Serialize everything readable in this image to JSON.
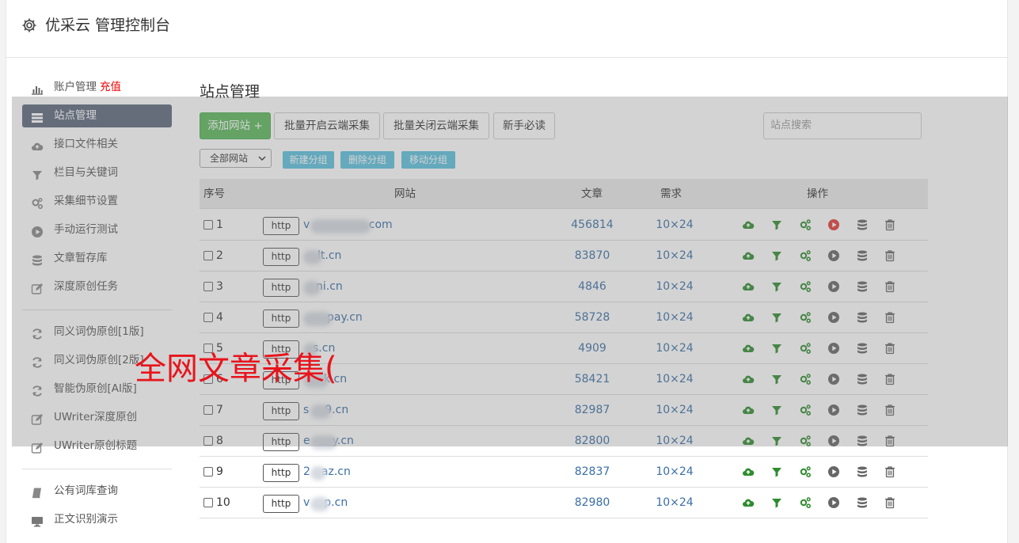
{
  "header": {
    "title": "优采云 管理控制台"
  },
  "sidebar": {
    "items": [
      {
        "label": "账户管理",
        "badge": "充值",
        "icon": "bar-chart-icon"
      },
      {
        "label": "站点管理",
        "icon": "list-icon",
        "active": true
      },
      {
        "label": "接口文件相关",
        "icon": "cloud-upload-icon"
      },
      {
        "label": "栏目与关键词",
        "icon": "filter-icon"
      },
      {
        "label": "采集细节设置",
        "icon": "gears-icon"
      },
      {
        "label": "手动运行测试",
        "icon": "play-icon"
      },
      {
        "label": "文章暂存库",
        "icon": "database-icon"
      },
      {
        "label": "深度原创任务",
        "icon": "edit-icon"
      },
      {
        "label": "同义词伪原创[1版]",
        "icon": "refresh-icon"
      },
      {
        "label": "同义词伪原创[2版]",
        "icon": "refresh-icon"
      },
      {
        "label": "智能伪原创[AI版]",
        "icon": "refresh-icon"
      },
      {
        "label": "UWriter深度原创",
        "icon": "edit-icon"
      },
      {
        "label": "UWriter原创标题",
        "icon": "edit-icon"
      },
      {
        "label": "公有词库查询",
        "icon": "book-icon"
      },
      {
        "label": "正文识别演示",
        "icon": "monitor-icon"
      }
    ]
  },
  "main": {
    "title": "站点管理",
    "toolbar": {
      "add_label": "添加网站 +",
      "batch_open_label": "批量开启云端采集",
      "batch_close_label": "批量关闭云端采集",
      "guide_label": "新手必读",
      "search_placeholder": "站点搜索"
    },
    "group": {
      "select_value": "全部网站",
      "new_label": "新建分组",
      "delete_label": "删除分组",
      "move_label": "移动分组"
    },
    "table": {
      "headers": {
        "index": "序号",
        "site": "网站",
        "article": "文章",
        "need": "需求",
        "ops": "操作"
      },
      "http_label": "http",
      "rows": [
        {
          "num": "1",
          "site_prefix": "v",
          "site_suffix": ".com",
          "articles": "456814",
          "need": "10×24",
          "play_active": true
        },
        {
          "num": "2",
          "site_prefix": "",
          "site_suffix": "lt.cn",
          "articles": "83870",
          "need": "10×24",
          "play_active": false
        },
        {
          "num": "3",
          "site_prefix": "",
          "site_suffix": "ni.cn",
          "articles": "4846",
          "need": "10×24",
          "play_active": false
        },
        {
          "num": "4",
          "site_prefix": "",
          "site_suffix": "pay.cn",
          "articles": "58728",
          "need": "10×24",
          "play_active": false
        },
        {
          "num": "5",
          "site_prefix": "",
          "site_suffix": "s.cn",
          "articles": "4909",
          "need": "10×24",
          "play_active": false
        },
        {
          "num": "6",
          "site_prefix": "",
          "site_suffix": "k.cn",
          "articles": "58421",
          "need": "10×24",
          "play_active": false
        },
        {
          "num": "7",
          "site_prefix": "s",
          "site_suffix": "9.cn",
          "articles": "82987",
          "need": "10×24",
          "play_active": false
        },
        {
          "num": "8",
          "site_prefix": "e",
          "site_suffix": "y.cn",
          "articles": "82800",
          "need": "10×24",
          "play_active": false
        },
        {
          "num": "9",
          "site_prefix": "2",
          "site_suffix": "az.cn",
          "articles": "82837",
          "need": "10×24",
          "play_active": false
        },
        {
          "num": "10",
          "site_prefix": "v",
          "site_suffix": "p.cn",
          "articles": "82980",
          "need": "10×24",
          "play_active": false
        }
      ]
    }
  },
  "watermark": {
    "text": "全网文章采集("
  },
  "colors": {
    "accent_green": "#5cb85c",
    "link_blue": "#3a6ea5",
    "icon_green": "#2e8b2e",
    "play_red": "#e53935",
    "info_blue": "#5bc0de",
    "active_nav": "#5b677d"
  }
}
